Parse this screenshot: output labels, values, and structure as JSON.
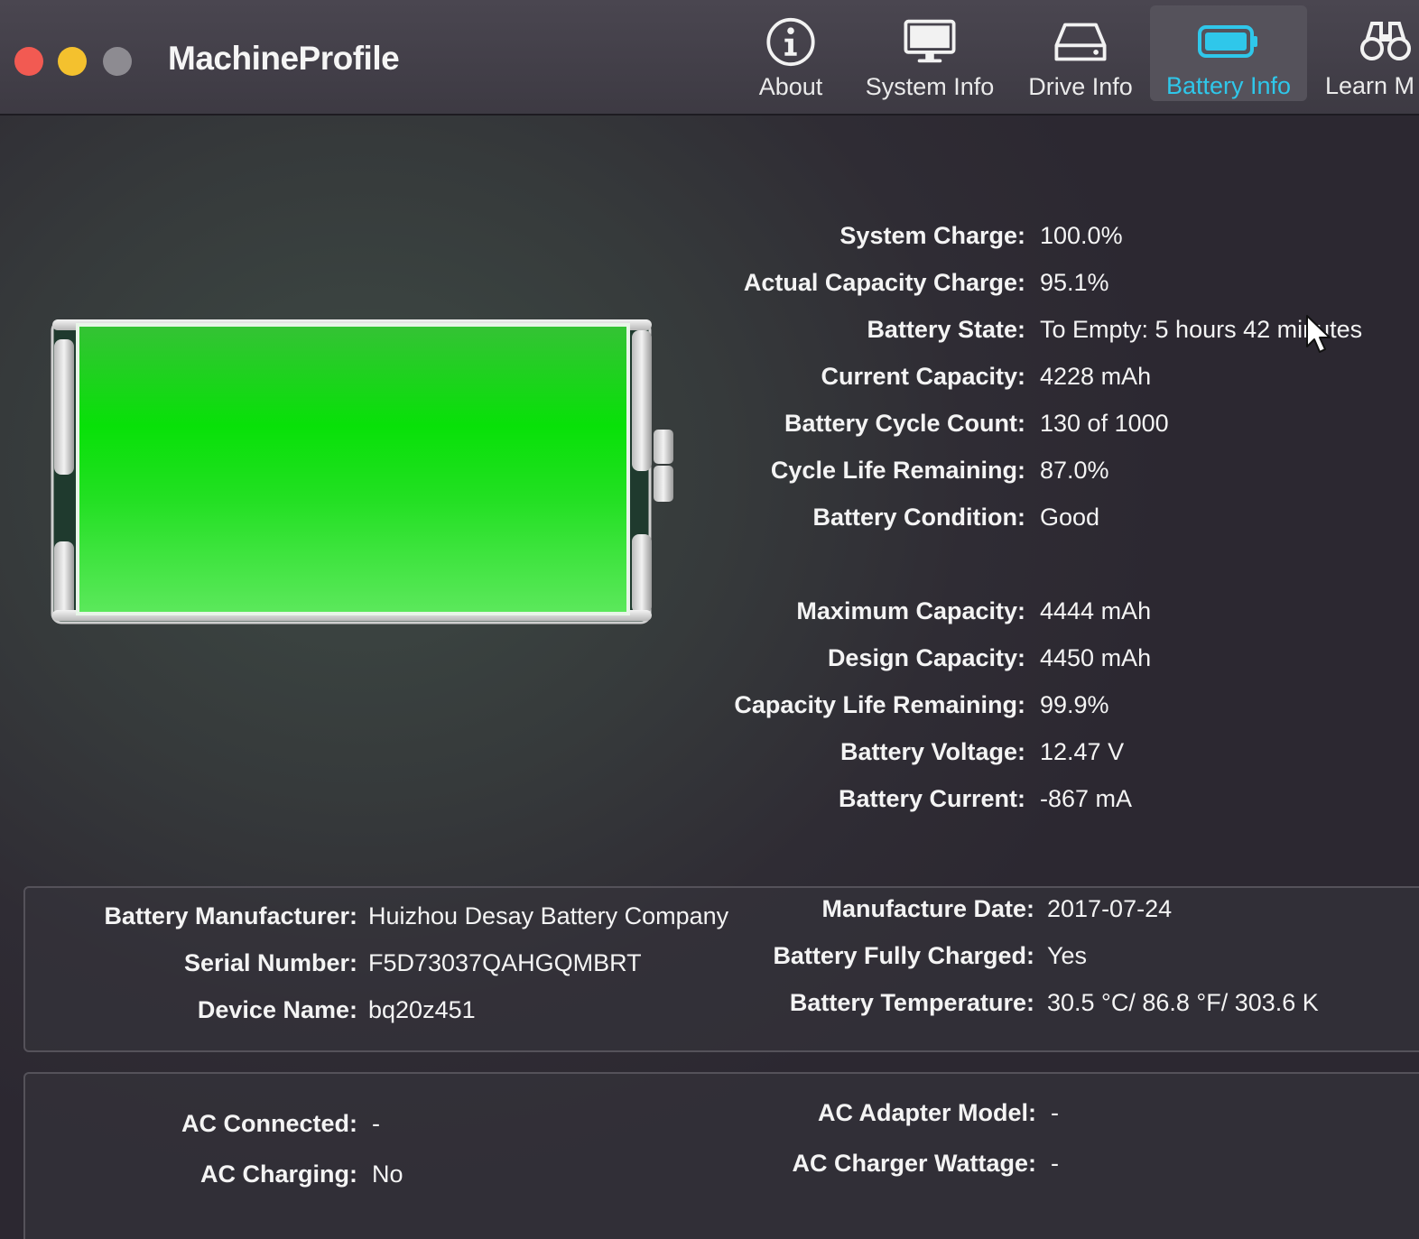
{
  "window": {
    "title": "MachineProfile",
    "traffic_lights": {
      "close": "#f25a52",
      "minimize": "#f4c12e",
      "zoom": "#8d8b91"
    }
  },
  "toolbar": {
    "tabs": [
      {
        "label": "About",
        "icon": "info-icon",
        "active": false
      },
      {
        "label": "System Info",
        "icon": "monitor-icon",
        "active": false
      },
      {
        "label": "Drive Info",
        "icon": "drive-icon",
        "active": false
      },
      {
        "label": "Battery Info",
        "icon": "battery-icon",
        "active": true
      },
      {
        "label": "Learn M",
        "icon": "binoculars-icon",
        "active": false
      }
    ],
    "active_color": "#2fc7ea"
  },
  "battery_graphic": {
    "charge_fraction": 1.0,
    "fill_color": "#22e022"
  },
  "battery_stats": [
    {
      "label": "System Charge:",
      "value": "100.0%"
    },
    {
      "label": "Actual Capacity Charge:",
      "value": "95.1%"
    },
    {
      "label": "Battery State:",
      "value": "To Empty: 5 hours 42 minutes"
    },
    {
      "label": "Current Capacity:",
      "value": "4228 mAh"
    },
    {
      "label": "Battery Cycle Count:",
      "value": "130 of 1000"
    },
    {
      "label": "Cycle Life Remaining:",
      "value": "87.0%"
    },
    {
      "label": "Battery Condition:",
      "value": "Good"
    }
  ],
  "capacity_stats": [
    {
      "label": "Maximum Capacity:",
      "value": "4444 mAh"
    },
    {
      "label": "Design Capacity:",
      "value": "4450 mAh"
    },
    {
      "label": "Capacity Life Remaining:",
      "value": "99.9%"
    },
    {
      "label": "Battery Voltage:",
      "value": "12.47 V"
    },
    {
      "label": "Battery Current:",
      "value": "-867 mA"
    }
  ],
  "hardware": {
    "left": [
      {
        "label": "Battery Manufacturer:",
        "value": "Huizhou Desay Battery Company"
      },
      {
        "label": "Serial Number:",
        "value": "F5D73037QAHGQMBRT"
      },
      {
        "label": "Device Name:",
        "value": "bq20z451"
      }
    ],
    "right": [
      {
        "label": "Manufacture Date:",
        "value": "2017-07-24"
      },
      {
        "label": "Battery Fully Charged:",
        "value": "Yes"
      },
      {
        "label": "Battery Temperature:",
        "value": "30.5 °C/ 86.8 °F/ 303.6 K"
      }
    ]
  },
  "ac": {
    "left": [
      {
        "label": "AC Connected:",
        "value": "-"
      },
      {
        "label": "AC Charging:",
        "value": "No"
      }
    ],
    "right": [
      {
        "label": "AC Adapter Model:",
        "value": "-"
      },
      {
        "label": "AC Charger Wattage:",
        "value": "-"
      }
    ]
  }
}
